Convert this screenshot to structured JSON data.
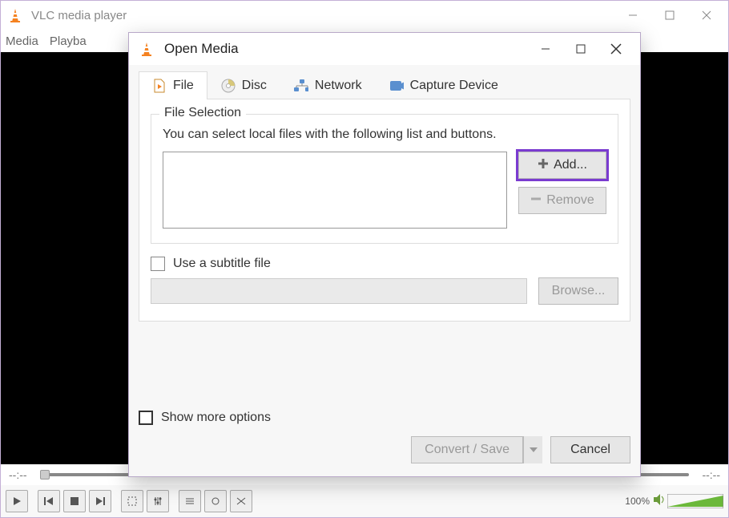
{
  "window": {
    "title": "VLC media player",
    "menu": {
      "media": "Media",
      "playback": "Playba"
    },
    "time_left": "--:--",
    "time_right": "--:--",
    "volume_label": "100%"
  },
  "dialog": {
    "title": "Open Media",
    "tabs": {
      "file": "File",
      "disc": "Disc",
      "network": "Network",
      "capture": "Capture Device"
    },
    "fileSelection": {
      "legend": "File Selection",
      "instruction": "You can select local files with the following list and buttons.",
      "add_label": "Add...",
      "remove_label": "Remove"
    },
    "subtitle": {
      "checkbox_label": "Use a subtitle file",
      "browse_label": "Browse..."
    },
    "show_more_label": "Show more options",
    "convert_label": "Convert / Save",
    "cancel_label": "Cancel"
  }
}
